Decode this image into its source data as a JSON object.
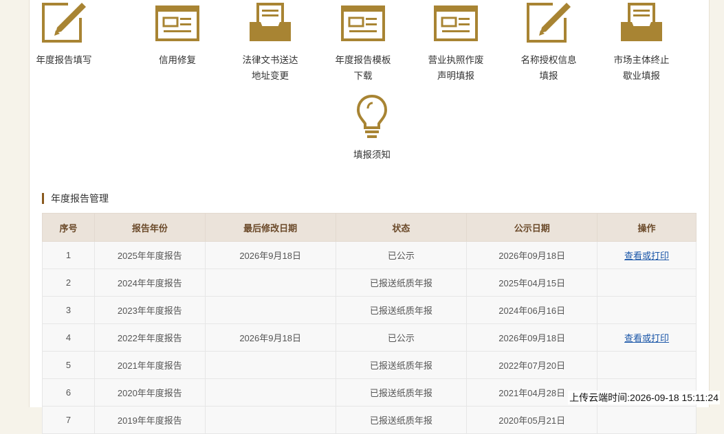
{
  "tiles": [
    {
      "icon": "pencil-edit-icon",
      "label1": "年度报告填写",
      "label2": ""
    },
    {
      "icon": "document-form-icon",
      "label1": "信用修复",
      "label2": ""
    },
    {
      "icon": "inbox-tray-icon",
      "label1": "法律文书送达",
      "label2": "地址变更"
    },
    {
      "icon": "document-form-icon",
      "label1": "年度报告模板",
      "label2": "下载"
    },
    {
      "icon": "document-form-icon",
      "label1": "营业执照作废",
      "label2": "声明填报"
    },
    {
      "icon": "pencil-edit-icon",
      "label1": "名称授权信息",
      "label2": "填报"
    },
    {
      "icon": "inbox-tray-icon",
      "label1": "市场主体终止",
      "label2": "歇业填报"
    },
    {
      "icon": "lightbulb-icon",
      "label1": "填报须知",
      "label2": ""
    }
  ],
  "section": {
    "title": "年度报告管理"
  },
  "table": {
    "headers": [
      "序号",
      "报告年份",
      "最后修改日期",
      "状态",
      "公示日期",
      "操作"
    ],
    "rows": [
      [
        "1",
        "2025年年度报告",
        "2026年9月18日",
        "已公示",
        "2026年09月18日",
        "查看或打印"
      ],
      [
        "2",
        "2024年年度报告",
        "",
        "已报送纸质年报",
        "2025年04月15日",
        ""
      ],
      [
        "3",
        "2023年年度报告",
        "",
        "已报送纸质年报",
        "2024年06月16日",
        ""
      ],
      [
        "4",
        "2022年年度报告",
        "2026年9月18日",
        "已公示",
        "2026年09月18日",
        "查看或打印"
      ],
      [
        "5",
        "2021年年度报告",
        "",
        "已报送纸质年报",
        "2022年07月20日",
        ""
      ],
      [
        "6",
        "2020年年度报告",
        "",
        "已报送纸质年报",
        "2021年04月28日",
        ""
      ],
      [
        "7",
        "2019年年度报告",
        "",
        "已报送纸质年报",
        "2020年05月21日",
        ""
      ]
    ]
  },
  "colors": {
    "icon_gold": "#a88433",
    "header_bg": "#ebe3da",
    "link": "#1a56a8",
    "accent": "#8a5a1e"
  },
  "timestamp": "上传云端时间:2026-09-18 15:11:24"
}
